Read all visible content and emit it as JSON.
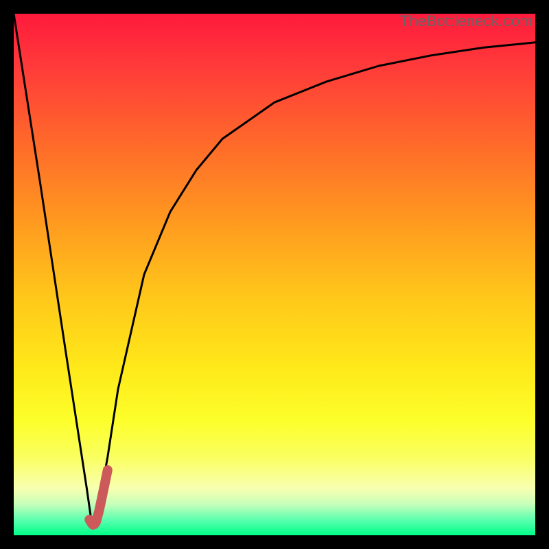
{
  "watermark": "TheBottleneck.com",
  "chart_data": {
    "type": "line",
    "title": "",
    "xlabel": "",
    "ylabel": "",
    "xlim": [
      0,
      100
    ],
    "ylim": [
      0,
      100
    ],
    "series": [
      {
        "name": "bottleneck-curve",
        "x": [
          0,
          5,
          10,
          12,
          14,
          15,
          16,
          18,
          20,
          25,
          30,
          35,
          40,
          50,
          60,
          70,
          80,
          90,
          100
        ],
        "y": [
          100,
          68,
          35,
          22,
          9,
          2,
          4,
          15,
          28,
          50,
          62,
          70,
          76,
          83,
          87,
          90,
          92,
          93.5,
          94.5
        ],
        "color": "#000000",
        "stroke_width": 3
      },
      {
        "name": "optimal-marker",
        "x": [
          14.5,
          15.0,
          15.2,
          15.5,
          15.8,
          16.4,
          17.2,
          18.0
        ],
        "y": [
          3.0,
          2.2,
          2.0,
          2.1,
          2.6,
          4.8,
          8.6,
          12.5
        ],
        "color": "#cc5a5a",
        "stroke_width": 14
      }
    ]
  }
}
